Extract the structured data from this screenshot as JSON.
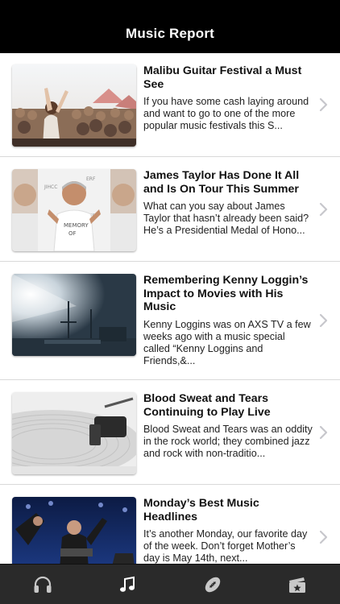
{
  "header": {
    "title": "Music Report"
  },
  "articles": [
    {
      "headline": "Malibu Guitar Festival a Must See",
      "summary": "If you have some cash laying around and want to go to one of the more popular music festivals this S..."
    },
    {
      "headline": "James Taylor Has Done It All and Is On Tour This Summer",
      "summary": "What can you say about James Taylor that hasn’t already been said? He’s a Presidential Medal of Hono..."
    },
    {
      "headline": "Remembering Kenny Loggin’s Impact to Movies with His Music",
      "summary": "Kenny Loggins was on AXS TV a few weeks ago with a music special called “Kenny Loggins and Friends,&..."
    },
    {
      "headline": "Blood Sweat and Tears Continuing to Play Live",
      "summary": "Blood Sweat and Tears was an oddity in the rock world; they combined jazz and rock with non-traditio..."
    },
    {
      "headline": "Monday’s Best Music Headlines",
      "summary": "It’s another Monday, our favorite day of the week. Don’t forget Mother’s day is May 14th, next..."
    }
  ],
  "tabs": [
    {
      "icon": "headphones-icon",
      "selected": false
    },
    {
      "icon": "music-note-icon",
      "selected": true
    },
    {
      "icon": "football-icon",
      "selected": false
    },
    {
      "icon": "ticket-icon",
      "selected": false
    }
  ],
  "colors": {
    "navbar": "#000000",
    "tabbar": "#2a2a2a",
    "tab_icon": "#c8c8c8",
    "tab_icon_selected": "#ffffff",
    "separator": "#d9d9d9",
    "chevron": "#c7c7cc"
  }
}
